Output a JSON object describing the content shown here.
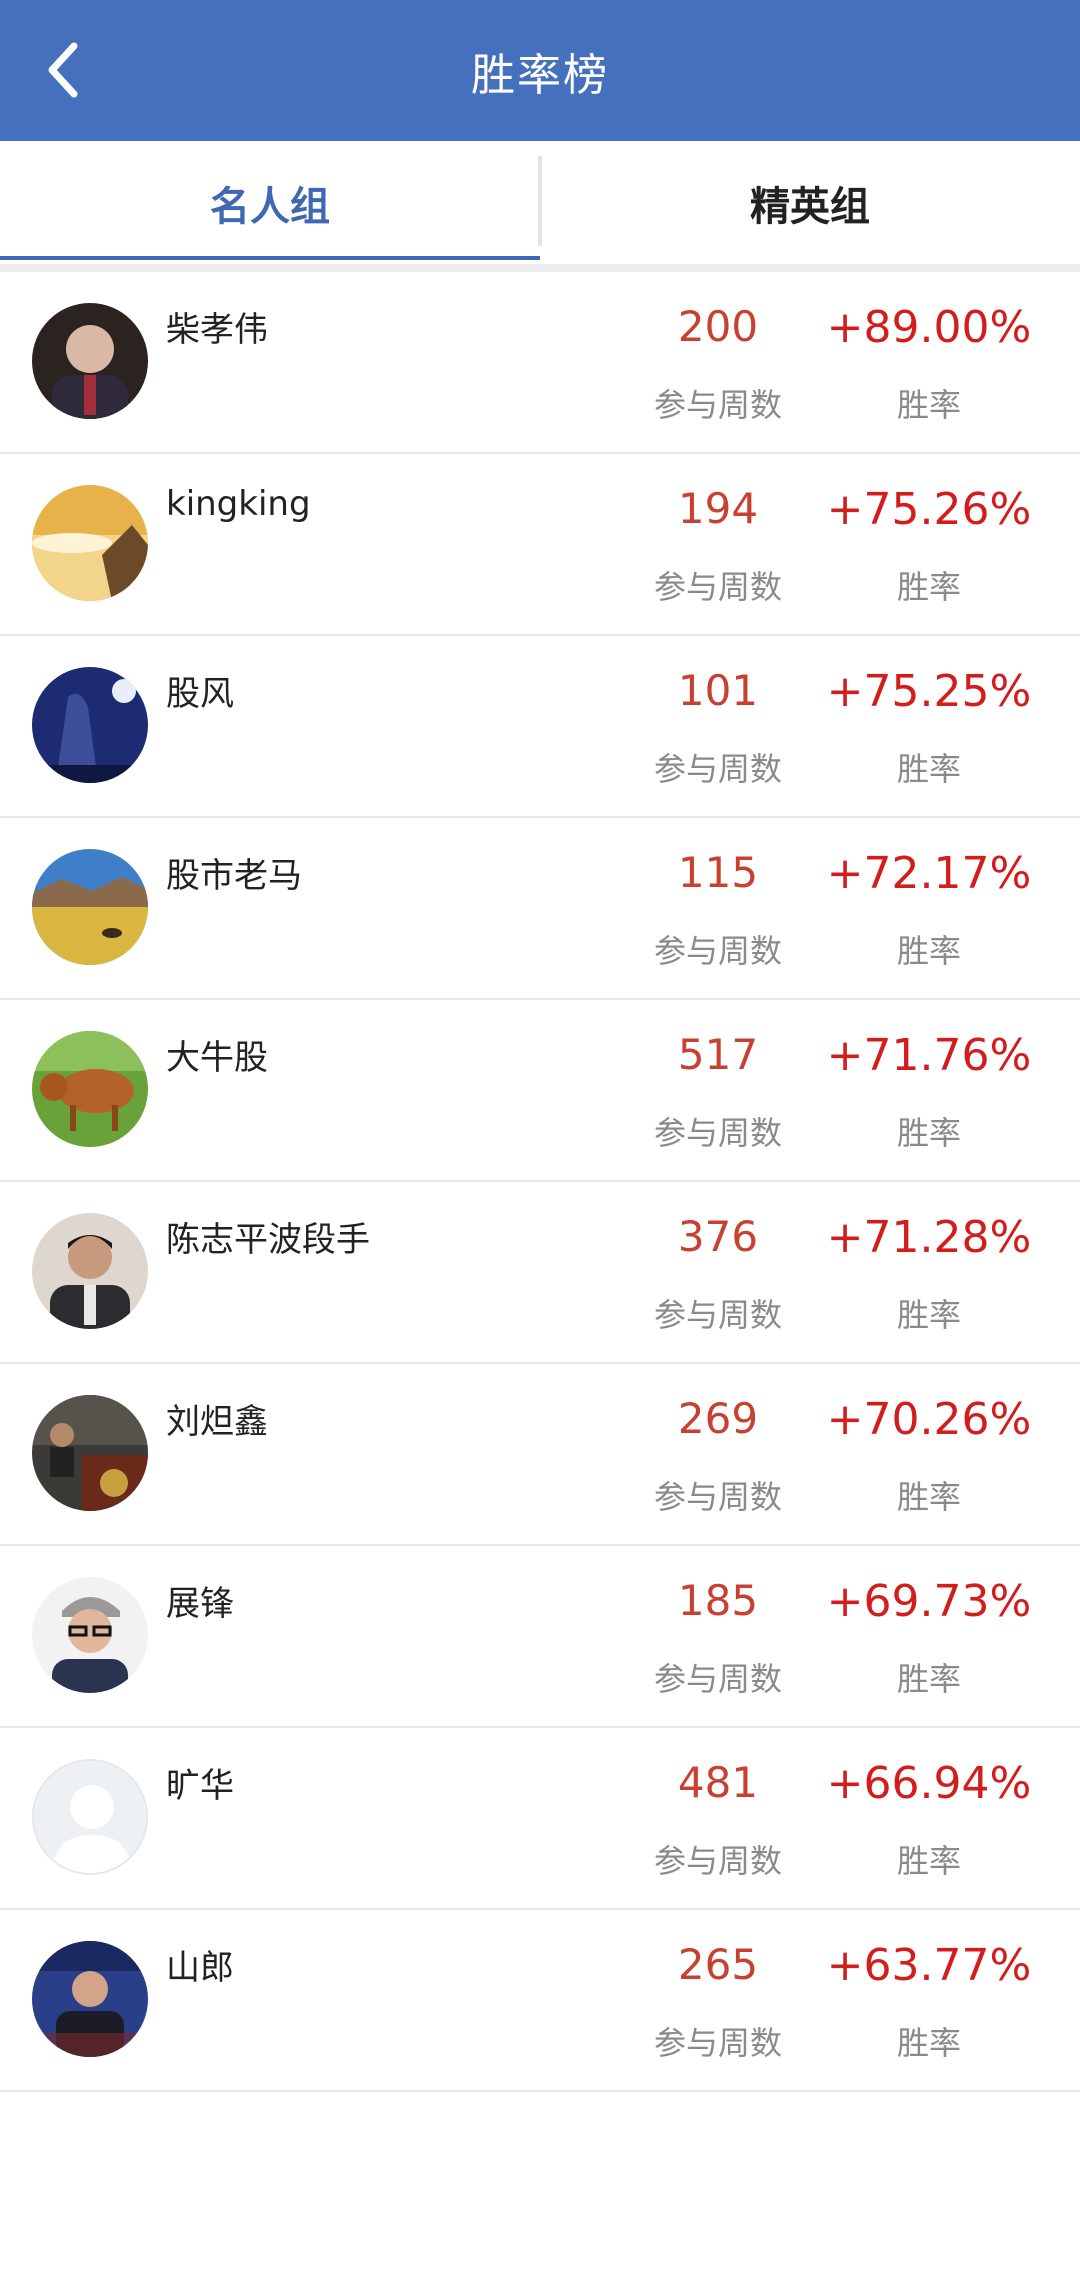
{
  "header": {
    "title": "胜率榜",
    "back_icon": "chevron-left-icon"
  },
  "tabs": [
    {
      "label": "名人组",
      "active": true
    },
    {
      "label": "精英组",
      "active": false
    }
  ],
  "column_labels": {
    "weeks": "参与周数",
    "rate": "胜率"
  },
  "colors": {
    "header_bg": "#4470be",
    "active_tab": "#3f68b2",
    "weeks_value": "#c8402f",
    "rate_value": "#d31d1d"
  },
  "rows": [
    {
      "name": "柴孝伟",
      "weeks": "200",
      "rate": "+89.00%"
    },
    {
      "name": "kingking",
      "weeks": "194",
      "rate": "+75.26%"
    },
    {
      "name": "股风",
      "weeks": "101",
      "rate": "+75.25%"
    },
    {
      "name": "股市老马",
      "weeks": "115",
      "rate": "+72.17%"
    },
    {
      "name": "大牛股",
      "weeks": "517",
      "rate": "+71.76%"
    },
    {
      "name": "陈志平波段手",
      "weeks": "376",
      "rate": "+71.28%"
    },
    {
      "name": "刘炟鑫",
      "weeks": "269",
      "rate": "+70.26%"
    },
    {
      "name": "展锋",
      "weeks": "185",
      "rate": "+69.73%"
    },
    {
      "name": "旷华",
      "weeks": "481",
      "rate": "+66.94%"
    },
    {
      "name": "山郎",
      "weeks": "265",
      "rate": "+63.77%"
    }
  ]
}
